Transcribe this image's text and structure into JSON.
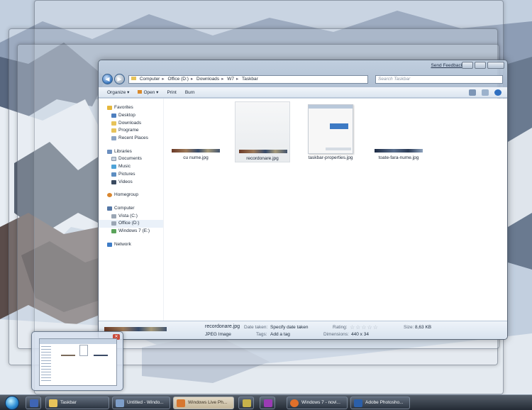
{
  "explorer": {
    "send_feedback": "Send Feedback",
    "breadcrumb": [
      "Computer",
      "Office (D:)",
      "Downloads",
      "W7",
      "Taskbar"
    ],
    "search_placeholder": "Search Taskbar",
    "toolbar": {
      "organize": "Organize ▾",
      "open": "Open ▾",
      "print": "Print",
      "burn": "Burn"
    },
    "nav": {
      "favorites": "Favorites",
      "desktop": "Desktop",
      "downloads": "Downloads",
      "programe": "Programe",
      "recent": "Recent Places",
      "libraries": "Libraries",
      "documents": "Documents",
      "music": "Music",
      "pictures": "Pictures",
      "videos": "Videos",
      "homegroup": "Homegroup",
      "computer": "Computer",
      "vista": "Vista (C:)",
      "office": "Office (D:)",
      "win7": "Windows 7 (E:)",
      "network": "Network"
    },
    "files": [
      {
        "name": "cu nume.jpg"
      },
      {
        "name": "recordonare.jpg"
      },
      {
        "name": "taskbar-properties.jpg"
      },
      {
        "name": "toate-fara-nume.jpg"
      }
    ],
    "details": {
      "filename": "recordonare.jpg",
      "filetype": "JPEG Image",
      "date_label": "Date taken:",
      "date_value": "Specify date taken",
      "tags_label": "Tags:",
      "tags_value": "Add a tag",
      "rating_label": "Rating:",
      "stars": "☆☆☆☆☆",
      "dim_label": "Dimensions:",
      "dim_value": "440 x 34",
      "size_label": "Size:",
      "size_value": "8,63 KB"
    }
  },
  "taskbar": {
    "items": [
      {
        "label": "",
        "icon_color": "#3f65b5"
      },
      {
        "label": "Taskbar",
        "icon_color": "#e9c45a"
      },
      {
        "label": "Untitled - Windo...",
        "icon_color": "#7e9ec8"
      },
      {
        "label": "Windows Live Ph...",
        "icon_color": "#d7772f"
      },
      {
        "label": "",
        "icon_color": "#c7b24a"
      },
      {
        "label": "",
        "icon_color": "#9b3bb4"
      },
      {
        "label": "Windows 7 - novi...",
        "icon_color": "#e2702a"
      },
      {
        "label": "Adobe Photosho...",
        "icon_color": "#2b5fa9"
      }
    ]
  },
  "colors": {
    "accent": "#3f7bc1",
    "taskbar": "#1f2a36",
    "selection": "#e8ebee"
  }
}
